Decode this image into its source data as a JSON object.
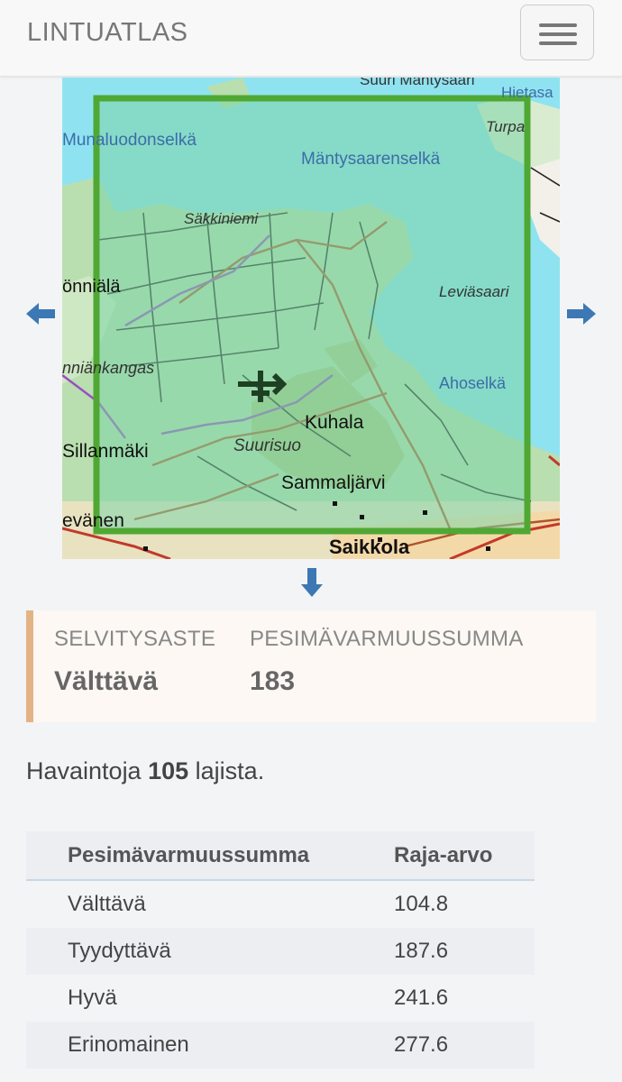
{
  "navbar": {
    "brand": "LINTUATLAS",
    "menu_icon": "hamburger-menu-icon"
  },
  "map": {
    "labels": [
      "Suuri Mäntysaari",
      "Hietasa",
      "Munaluodonselkä",
      "Turpa",
      "Mäntysaarenselkä",
      "Säkkiniemi",
      "önniälä",
      "Leviäsaari",
      "nniänkangas",
      "Ahoselkä",
      "Kuhala",
      "Sillanmäki",
      "Suurisuo",
      "Sammaljärvi",
      "evänen",
      "Saikkola"
    ],
    "colors": {
      "sea": "#8fe3f0",
      "land": "#b9deb0",
      "square_border": "#4fa833",
      "square_fill": "#7ed6a8"
    }
  },
  "nav_arrows": {
    "left": "arrow-left-icon",
    "right": "arrow-right-icon",
    "down": "arrow-down-icon",
    "color": "#3c78b4"
  },
  "status": {
    "selvitysaste_label": "SELVITYSASTE",
    "selvitysaste_value": "Välttävä",
    "summa_label": "PESIMÄVARMUUSSUMMA",
    "summa_value": "183"
  },
  "observations": {
    "prefix": "Havaintoja",
    "count": "105",
    "suffix": "lajista."
  },
  "thresholds": {
    "headers": [
      "Pesimävarmuussumma",
      "Raja-arvo"
    ],
    "rows": [
      {
        "name": "Välttävä",
        "value": "104.8"
      },
      {
        "name": "Tyydyttävä",
        "value": "187.6"
      },
      {
        "name": "Hyvä",
        "value": "241.6"
      },
      {
        "name": "Erinomainen",
        "value": "277.6"
      }
    ]
  }
}
